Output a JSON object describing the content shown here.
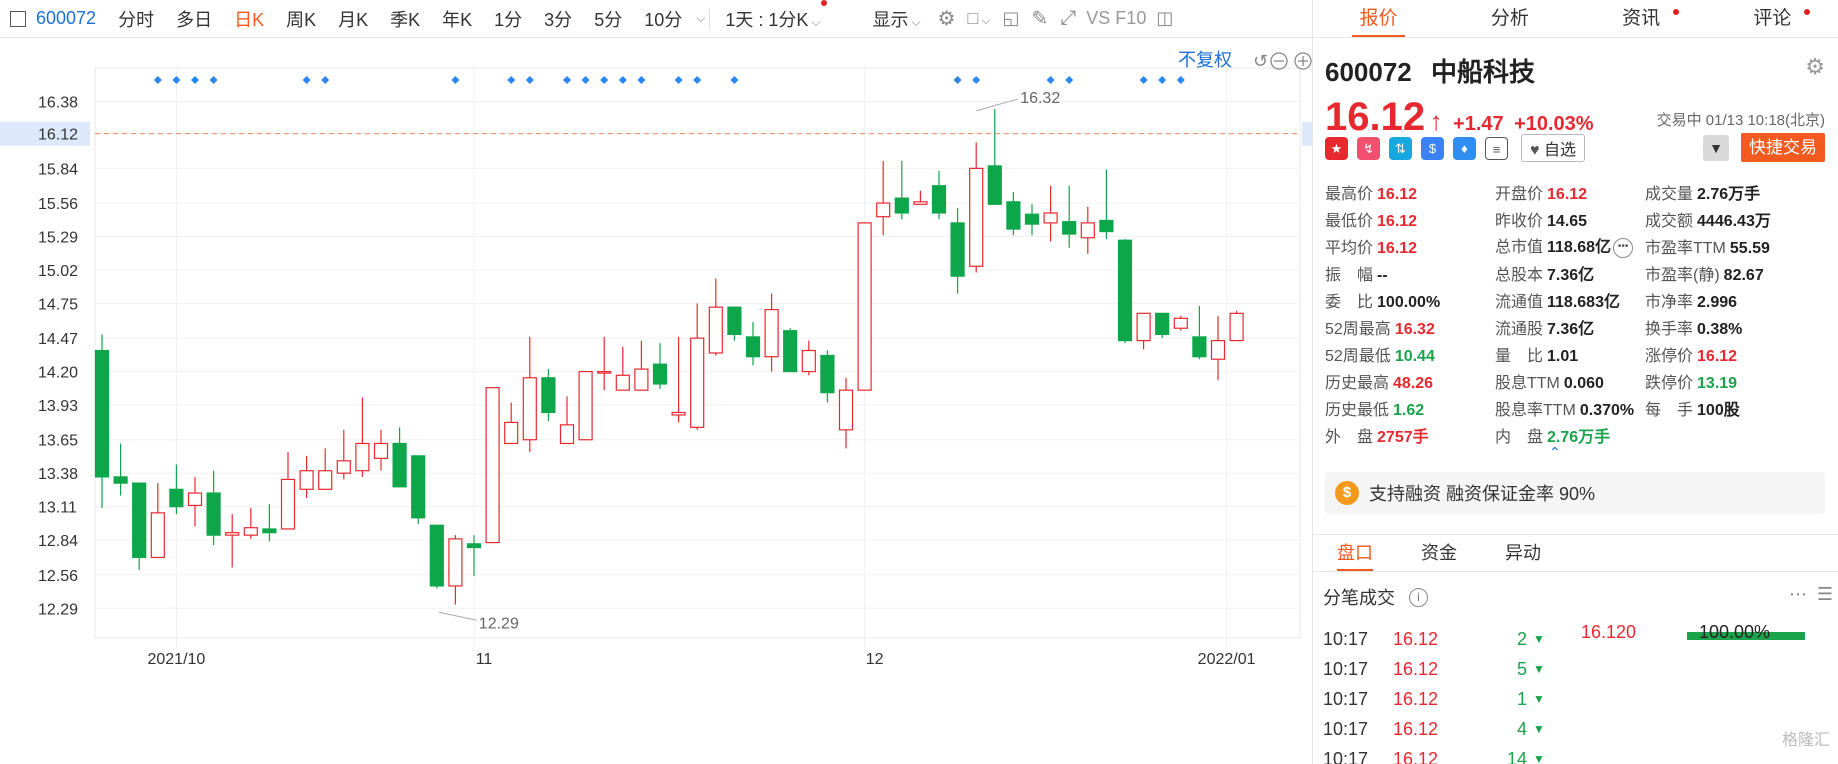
{
  "toolbar": {
    "code": "600072",
    "periods": [
      "分时",
      "多日",
      "日K",
      "周K",
      "月K",
      "季K",
      "年K",
      "1分",
      "3分",
      "5分",
      "10分"
    ],
    "active": "日K",
    "interval": "1天 : 1分K",
    "display": "显示",
    "right_label": "VS F10"
  },
  "chart_top": {
    "fq_label": "不复权"
  },
  "chart_data": {
    "type": "candlestick",
    "y_ticks": [
      "16.38",
      "16.12",
      "15.84",
      "15.56",
      "15.29",
      "15.02",
      "14.75",
      "14.47",
      "14.20",
      "13.93",
      "13.65",
      "13.38",
      "13.11",
      "12.84",
      "12.56",
      "12.29"
    ],
    "y_range": [
      12.05,
      16.65
    ],
    "x_labels": [
      {
        "label": "2021/10",
        "index": 4
      },
      {
        "label": "11",
        "index": 20
      },
      {
        "label": "12",
        "index": 41
      },
      {
        "label": "2022/01",
        "index": 61
      }
    ],
    "current_price": "16.12",
    "high_marker": {
      "value": "16.32",
      "index": 47
    },
    "low_marker": {
      "value": "12.29",
      "index": 18
    },
    "event_dot_indices": [
      3,
      4,
      5,
      6,
      11,
      12,
      19,
      22,
      23,
      25,
      26,
      27,
      28,
      29,
      31,
      32,
      34,
      46,
      47,
      51,
      52,
      56,
      57,
      58
    ],
    "candles": [
      [
        14.37,
        13.35,
        14.5,
        13.1
      ],
      [
        13.35,
        13.3,
        13.62,
        13.2
      ],
      [
        13.3,
        12.7,
        13.3,
        12.6
      ],
      [
        12.7,
        13.06,
        13.3,
        12.7
      ],
      [
        13.25,
        13.11,
        13.45,
        13.05
      ],
      [
        13.12,
        13.22,
        13.35,
        12.95
      ],
      [
        13.22,
        12.88,
        13.4,
        12.8
      ],
      [
        12.88,
        12.9,
        13.05,
        12.62
      ],
      [
        12.88,
        12.94,
        13.1,
        12.85
      ],
      [
        12.93,
        12.9,
        13.13,
        12.83
      ],
      [
        12.93,
        13.33,
        13.55,
        12.93
      ],
      [
        13.25,
        13.4,
        13.52,
        13.18
      ],
      [
        13.25,
        13.4,
        13.58,
        13.25
      ],
      [
        13.38,
        13.48,
        13.73,
        13.33
      ],
      [
        13.4,
        13.62,
        13.99,
        13.35
      ],
      [
        13.5,
        13.62,
        13.73,
        13.4
      ],
      [
        13.62,
        13.27,
        13.75,
        13.27
      ],
      [
        13.52,
        13.02,
        13.52,
        12.97
      ],
      [
        12.96,
        12.47,
        12.96,
        12.45
      ],
      [
        12.47,
        12.85,
        12.88,
        12.32
      ],
      [
        12.81,
        12.78,
        12.88,
        12.55
      ],
      [
        12.82,
        14.07,
        14.07,
        12.82
      ],
      [
        13.62,
        13.79,
        13.95,
        13.62
      ],
      [
        13.65,
        14.15,
        14.48,
        13.55
      ],
      [
        14.15,
        13.87,
        14.22,
        13.8
      ],
      [
        13.62,
        13.77,
        14.0,
        13.62
      ],
      [
        13.65,
        14.2,
        14.2,
        13.65
      ],
      [
        14.2,
        14.2,
        14.48,
        14.05
      ],
      [
        14.05,
        14.17,
        14.4,
        14.05
      ],
      [
        14.05,
        14.22,
        14.45,
        14.05
      ],
      [
        14.26,
        14.1,
        14.43,
        14.06
      ],
      [
        13.85,
        13.87,
        14.48,
        13.79
      ],
      [
        13.75,
        14.47,
        14.75,
        13.73
      ],
      [
        14.35,
        14.72,
        14.95,
        14.33
      ],
      [
        14.72,
        14.5,
        14.72,
        14.45
      ],
      [
        14.48,
        14.32,
        14.6,
        14.25
      ],
      [
        14.32,
        14.7,
        14.83,
        14.2
      ],
      [
        14.53,
        14.2,
        14.55,
        14.2
      ],
      [
        14.2,
        14.37,
        14.45,
        14.17
      ],
      [
        14.33,
        14.03,
        14.37,
        13.95
      ],
      [
        13.73,
        14.05,
        14.15,
        13.58
      ],
      [
        14.05,
        15.4,
        15.4,
        14.05
      ],
      [
        15.45,
        15.56,
        15.9,
        15.3
      ],
      [
        15.6,
        15.48,
        15.9,
        15.43
      ],
      [
        15.55,
        15.57,
        15.66,
        15.55
      ],
      [
        15.7,
        15.48,
        15.82,
        15.43
      ],
      [
        15.4,
        14.97,
        15.52,
        14.83
      ],
      [
        15.05,
        15.84,
        16.05,
        15.0
      ],
      [
        15.86,
        15.55,
        16.32,
        15.55
      ],
      [
        15.57,
        15.35,
        15.65,
        15.3
      ],
      [
        15.47,
        15.39,
        15.55,
        15.3
      ],
      [
        15.4,
        15.48,
        15.7,
        15.25
      ],
      [
        15.41,
        15.31,
        15.7,
        15.2
      ],
      [
        15.28,
        15.4,
        15.53,
        15.15
      ],
      [
        15.42,
        15.33,
        15.83,
        15.27
      ],
      [
        15.26,
        14.45,
        15.27,
        14.43
      ],
      [
        14.45,
        14.67,
        14.67,
        14.38
      ],
      [
        14.67,
        14.5,
        14.67,
        14.47
      ],
      [
        14.55,
        14.63,
        14.65,
        14.53
      ],
      [
        14.48,
        14.32,
        14.73,
        14.3
      ],
      [
        14.3,
        14.45,
        14.65,
        14.13
      ],
      [
        14.45,
        14.67,
        14.69,
        14.45
      ]
    ]
  },
  "side": {
    "tabs": [
      {
        "label": "报价",
        "active": true,
        "dot": false
      },
      {
        "label": "分析",
        "active": false,
        "dot": false
      },
      {
        "label": "资讯",
        "active": false,
        "dot": true
      },
      {
        "label": "评论",
        "active": false,
        "dot": true
      }
    ],
    "code": "600072",
    "name": "中船科技",
    "price": "16.12",
    "change": "+1.47",
    "change_pct": "+10.03%",
    "status": "交易中 01/13 10:18(北京)",
    "watch_label": "自选",
    "quick_trade": "快捷交易",
    "quote_rows": [
      [
        [
          "最高价",
          "16.12",
          "red"
        ],
        [
          "开盘价",
          "16.12",
          "red"
        ],
        [
          "成交量",
          "2.76万手",
          "blk"
        ]
      ],
      [
        [
          "最低价",
          "16.12",
          "red"
        ],
        [
          "昨收价",
          "14.65",
          "blk"
        ],
        [
          "成交额",
          "4446.43万",
          "blk"
        ]
      ],
      [
        [
          "平均价",
          "16.12",
          "red"
        ],
        [
          "总市值",
          "118.68亿",
          "blk"
        ],
        [
          "市盈率TTM",
          "55.59",
          "blk"
        ]
      ],
      [
        [
          "振　幅",
          "--",
          "blk"
        ],
        [
          "总股本",
          "7.36亿",
          "blk"
        ],
        [
          "市盈率(静)",
          "82.67",
          "blk"
        ]
      ],
      [
        [
          "委　比",
          "100.00%",
          "blk"
        ],
        [
          "流通值",
          "118.683亿",
          "blk"
        ],
        [
          "市净率",
          "2.996",
          "blk"
        ]
      ],
      [
        [
          "52周最高",
          "16.32",
          "red"
        ],
        [
          "流通股",
          "7.36亿",
          "blk"
        ],
        [
          "换手率",
          "0.38%",
          "blk"
        ]
      ],
      [
        [
          "52周最低",
          "10.44",
          "green"
        ],
        [
          "量　比",
          "1.01",
          "blk"
        ],
        [
          "涨停价",
          "16.12",
          "red"
        ]
      ],
      [
        [
          "历史最高",
          "48.26",
          "red"
        ],
        [
          "股息TTM",
          "0.060",
          "blk"
        ],
        [
          "跌停价",
          "13.19",
          "green"
        ]
      ],
      [
        [
          "历史最低",
          "1.62",
          "green"
        ],
        [
          "股息率TTM",
          "0.370%",
          "blk"
        ],
        [
          "每　手",
          "100股",
          "blk"
        ]
      ],
      [
        [
          "外　盘",
          "2757手",
          "red"
        ],
        [
          "内　盘",
          "2.76万手",
          "green"
        ],
        [
          "",
          "",
          "blk"
        ]
      ]
    ],
    "margin_text": "支持融资 融资保证金率 90%",
    "sub_tabs": [
      "盘口",
      "资金",
      "异动"
    ],
    "tick_title": "分笔成交",
    "ticks": [
      {
        "time": "10:17",
        "price": "16.12",
        "vol": "2"
      },
      {
        "time": "10:17",
        "price": "16.12",
        "vol": "5"
      },
      {
        "time": "10:17",
        "price": "16.12",
        "vol": "1"
      },
      {
        "time": "10:17",
        "price": "16.12",
        "vol": "4"
      },
      {
        "time": "10:17",
        "price": "16.12",
        "vol": "14"
      }
    ],
    "dist_price": "16.120",
    "dist_pct": "100.00%",
    "watermark": "格隆汇"
  },
  "colors": {
    "up": "#e7292f",
    "down": "#0ea64b",
    "accent": "#f25a1f",
    "link": "#1e6fd9"
  }
}
